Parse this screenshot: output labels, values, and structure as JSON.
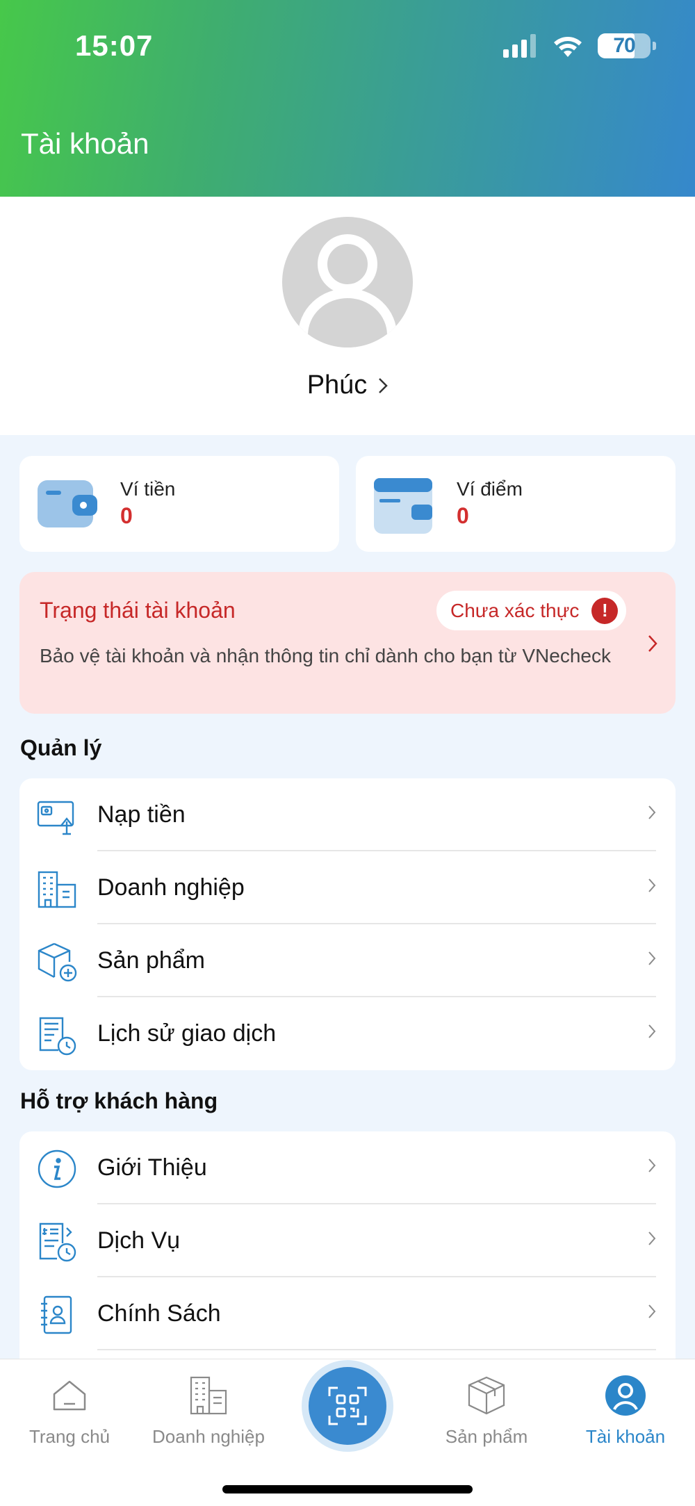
{
  "status_bar": {
    "time": "15:07",
    "battery": "70"
  },
  "header": {
    "title": "Tài khoản"
  },
  "profile": {
    "name": "Phúc"
  },
  "wallets": [
    {
      "label": "Ví tiền",
      "value": "0"
    },
    {
      "label": "Ví điểm",
      "value": "0"
    }
  ],
  "account_status": {
    "title": "Trạng thái tài khoản",
    "badge": "Chưa xác thực",
    "description": "Bảo vệ tài khoản và nhận thông tin chỉ dành cho bạn từ VNecheck"
  },
  "management": {
    "title": "Quản lý",
    "items": [
      {
        "label": "Nạp tiền",
        "icon": "deposit-icon"
      },
      {
        "label": "Doanh nghiệp",
        "icon": "building-icon"
      },
      {
        "label": "Sản phẩm",
        "icon": "product-box-icon"
      },
      {
        "label": "Lịch sử giao dịch",
        "icon": "transaction-history-icon"
      }
    ]
  },
  "support": {
    "title": "Hỗ trợ khách hàng",
    "items": [
      {
        "label": "Giới Thiệu",
        "icon": "info-icon"
      },
      {
        "label": "Dịch Vụ",
        "icon": "service-icon"
      },
      {
        "label": "Chính Sách",
        "icon": "policy-icon"
      }
    ]
  },
  "tabbar": {
    "tabs": [
      {
        "label": "Trang chủ",
        "icon": "home-icon"
      },
      {
        "label": "Doanh nghiệp",
        "icon": "building-icon"
      },
      {
        "label": "",
        "icon": "qr-scan-icon"
      },
      {
        "label": "Sản phẩm",
        "icon": "box-icon"
      },
      {
        "label": "Tài khoản",
        "icon": "account-icon"
      }
    ],
    "active": "Tài khoản"
  },
  "colors": {
    "accent": "#2b86c9",
    "danger": "#c62828",
    "gradient_start": "#47c84a",
    "gradient_end": "#3688cc"
  }
}
